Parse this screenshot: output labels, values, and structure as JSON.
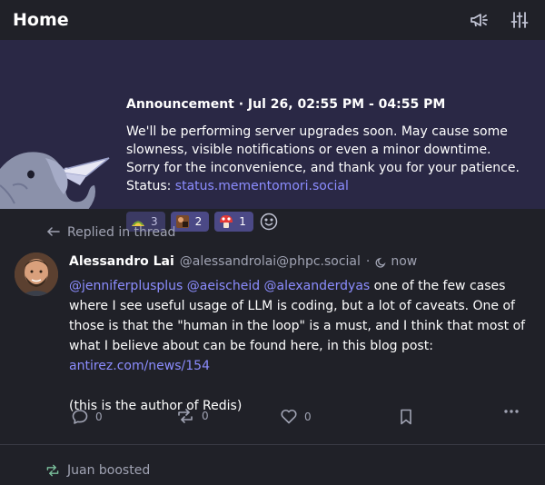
{
  "header": {
    "title": "Home",
    "announcements_icon": "megaphone-icon",
    "settings_icon": "sliders-icon"
  },
  "announcement": {
    "meta": "Announcement · Jul 26, 02:55 PM - 04:55 PM",
    "text": "We'll be performing server upgrades soon. May cause some slowness, visible notifications or even a minor downtime. Sorry for the inconvenience, and thank you for your patience. Status: ",
    "link": "status.mementomori.social",
    "reactions": [
      {
        "emoji": "taco-emoji",
        "count": "3"
      },
      {
        "emoji": "custom-emoji",
        "count": "2"
      },
      {
        "emoji": "mushroom-emoji",
        "count": "1"
      }
    ]
  },
  "status": {
    "prepend": "Replied in thread",
    "display_name": "Alessandro Lai",
    "account": "@alessandrolai@phpc.social",
    "separator": "·",
    "time": "now",
    "mentions": "@jenniferplusplus @aeischeid @alexanderdyas",
    "text1": " one of the few cases where I see useful usage of LLM is coding, but a lot of caveats. One of those is that the \"human in the loop\" is a must, and I think that most of what I believe about can be found here, in this blog post: ",
    "link": "antirez.com/news/154",
    "text2": "(this is the author of Redis)",
    "replies": "0",
    "boosts": "0",
    "favourites": "0"
  },
  "next": {
    "prepend": "Juan boosted"
  },
  "colors": {
    "accent": "#8c8dff",
    "boost": "#79bd9a",
    "announcement_bg": "#2a2845"
  }
}
